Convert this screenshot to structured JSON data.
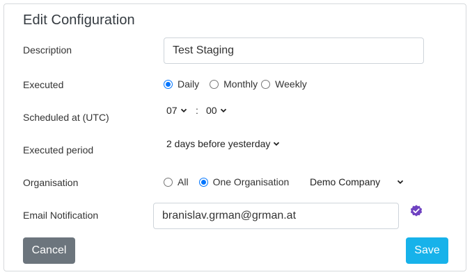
{
  "title": "Edit Configuration",
  "description": {
    "label": "Description",
    "value": "Test Staging"
  },
  "executed": {
    "label": "Executed",
    "options": [
      "Daily",
      "Monthly",
      "Weekly"
    ],
    "selected": "Daily"
  },
  "scheduled": {
    "label": "Scheduled at (UTC)",
    "hour": "07",
    "separator": ":",
    "minute": "00"
  },
  "period": {
    "label": "Executed period",
    "value": "2 days before yesterday"
  },
  "organisation": {
    "label": "Organisation",
    "options": [
      "All",
      "One Organisation"
    ],
    "selected": "One Organisation",
    "company": "Demo Company"
  },
  "email": {
    "label": "Email Notification",
    "value": "branislav.grman@grman.at"
  },
  "buttons": {
    "cancel": "Cancel",
    "save": "Save"
  },
  "colors": {
    "accent": "#0075ff",
    "save": "#17b2ea",
    "cancel": "#6c757d",
    "verified": "#6f42c1"
  },
  "icons": {
    "verified": "verified-badge-icon",
    "chevron": "chevron-down-icon"
  }
}
